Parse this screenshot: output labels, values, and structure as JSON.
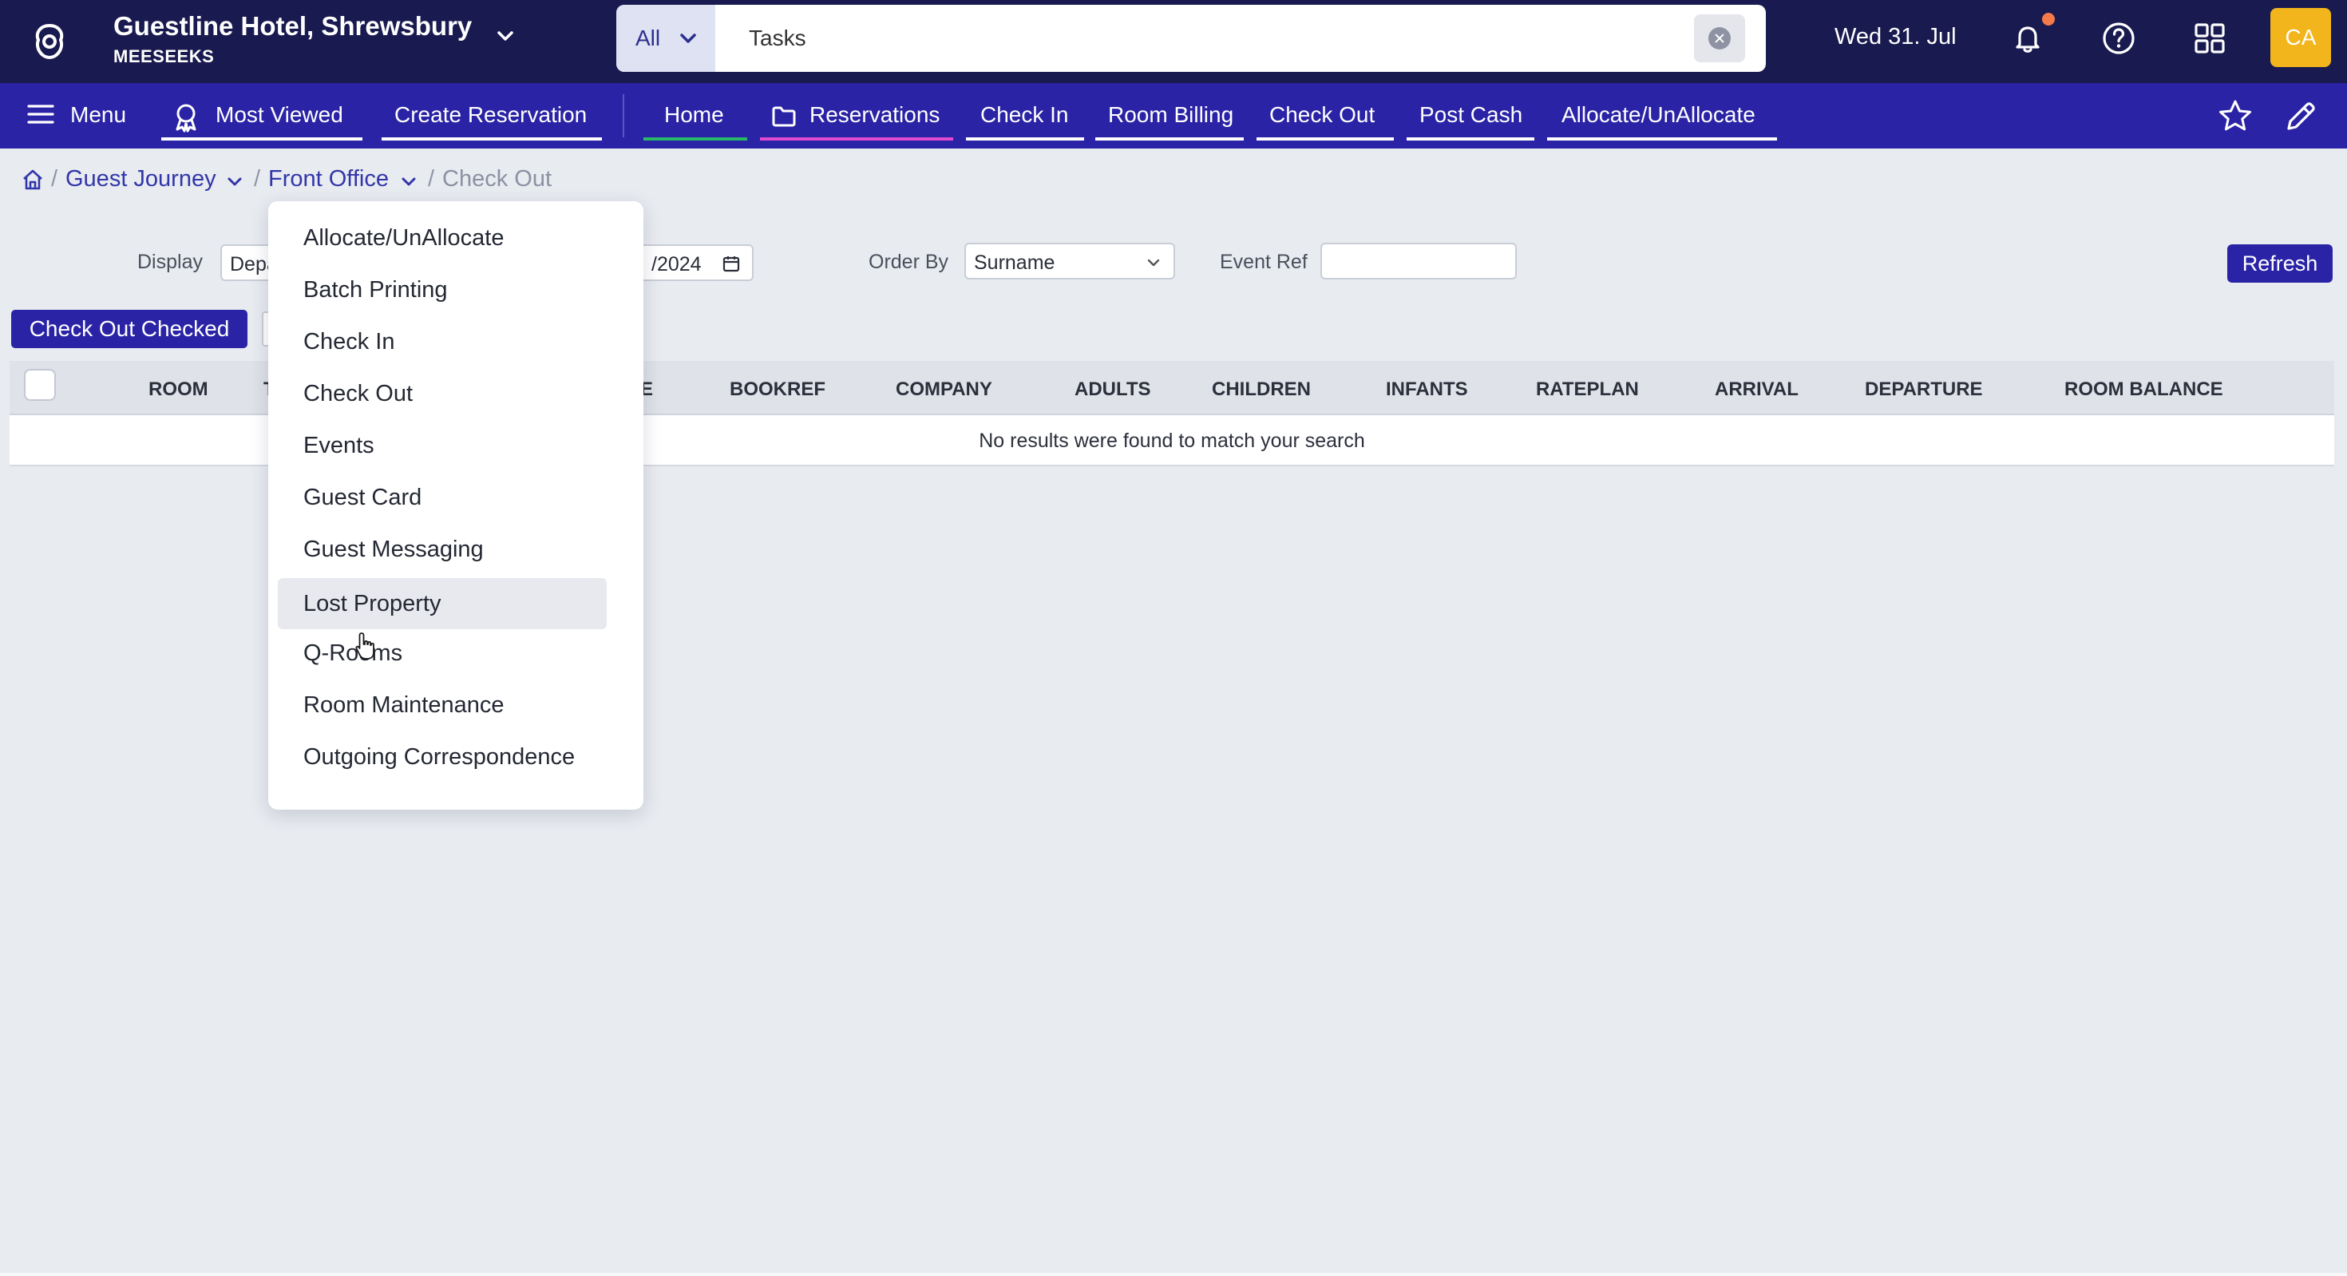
{
  "header": {
    "hotel_name": "Guestline Hotel, Shrewsbury",
    "hotel_sub": "MEESEEKS",
    "search_scope": "All",
    "search_value": "Tasks",
    "date": "Wed 31. Jul",
    "avatar_initials": "CA",
    "colors": {
      "topbar": "#191a4f",
      "accent": "#2a23a6",
      "avatar": "#f2b51c",
      "notification": "#f47a4a"
    }
  },
  "nav": {
    "menu": "Menu",
    "most_viewed": "Most Viewed",
    "create_reservation": "Create Reservation",
    "home": "Home",
    "reservations": "Reservations",
    "check_in": "Check In",
    "room_billing": "Room Billing",
    "check_out": "Check Out",
    "post_cash": "Post Cash",
    "allocate": "Allocate/UnAllocate"
  },
  "breadcrumb": {
    "guest_journey": "Guest Journey",
    "front_office": "Front Office",
    "current": "Check Out"
  },
  "filters": {
    "display_label": "Display",
    "display_value": "Depa",
    "date_value": "/2024",
    "order_by_label": "Order By",
    "order_by_value": "Surname",
    "event_ref_label": "Event Ref",
    "event_ref_value": "",
    "refresh": "Refresh"
  },
  "actions": {
    "check_out_checked": "Check Out Checked"
  },
  "table": {
    "columns": {
      "room": "ROOM",
      "col_t": "T",
      "col_e": "E",
      "bookref": "BOOKREF",
      "company": "COMPANY",
      "adults": "ADULTS",
      "children": "CHILDREN",
      "infants": "INFANTS",
      "rateplan": "RATEPLAN",
      "arrival": "ARRIVAL",
      "departure": "DEPARTURE",
      "room_balance": "ROOM BALANCE"
    },
    "empty_message": "No results were found to match your search"
  },
  "dropdown": {
    "items": [
      "Allocate/UnAllocate",
      "Batch Printing",
      "Check In",
      "Check Out",
      "Events",
      "Guest Card",
      "Guest Messaging",
      "Lost Property",
      "Q-Rooms",
      "Room Maintenance",
      "Outgoing Correspondence"
    ],
    "hovered": "Lost Property"
  }
}
